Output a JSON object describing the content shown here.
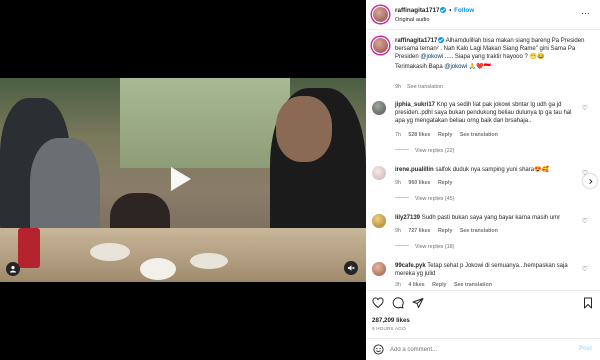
{
  "post": {
    "username": "raffinagita1717",
    "subtitle": "Original audio",
    "follow_label": "Follow",
    "dot": "•"
  },
  "caption": {
    "username": "raffinagita1717",
    "text_part1": " Alhamdulillah bisa makan siang bareng Pa Presiden bersama teman² . Nah Kalo Lagi Makan Siang Rame\" gini Sama Pa Presiden ",
    "mention1": "@jokowi",
    "text_part2": " ..... Siapa yang traktir hayooo ? 😁😂",
    "line2_text": "Terimakasih Bapa ",
    "mention2": "@jokowi",
    "line2_end": " 🙏❤️🇮🇩",
    "time": "9h",
    "see_translation": "See translation"
  },
  "comments": [
    {
      "username": "jiphia_sukri17",
      "text": " Knp ya sedih liat pak jokowi sbntar lg udh ga jd presiden..pdhl saya bukan pendukung beliau dulunya tp ga tau hal apa yg mengatakan beliau orng baik dan brsahaja..",
      "time": "7h",
      "likes": "528 likes",
      "reply": "Reply",
      "see_translation": "See translation",
      "views": "View replies (22)"
    },
    {
      "username": "irene.pualillin",
      "text": " salfok duduk nya samping yuni shara😍🥰",
      "time": "9h",
      "likes": "960 likes",
      "reply": "Reply",
      "see_translation": "",
      "views": "View replies (45)"
    },
    {
      "username": "lily27139",
      "text": " Sudh pasti bukan saya yang bayar karna masih umr",
      "time": "9h",
      "likes": "727 likes",
      "reply": "Reply",
      "see_translation": "See translation",
      "views": "View replies (18)"
    },
    {
      "username": "99cafe.pyk",
      "text": " Tetap sehat p Jokowi di semuanya...hempaskan saja mereka yg julid",
      "time": "3h",
      "likes": "4 likes",
      "reply": "Reply",
      "see_translation": "See translation",
      "views": ""
    }
  ],
  "actions": {
    "likes": "287,209 likes",
    "time_ago": "9 HOURS AGO"
  },
  "add_comment": {
    "placeholder": "Add a comment...",
    "post_label": "Post"
  },
  "colors": {
    "accent": "#0095f6",
    "text": "#262626",
    "muted": "#737373"
  }
}
